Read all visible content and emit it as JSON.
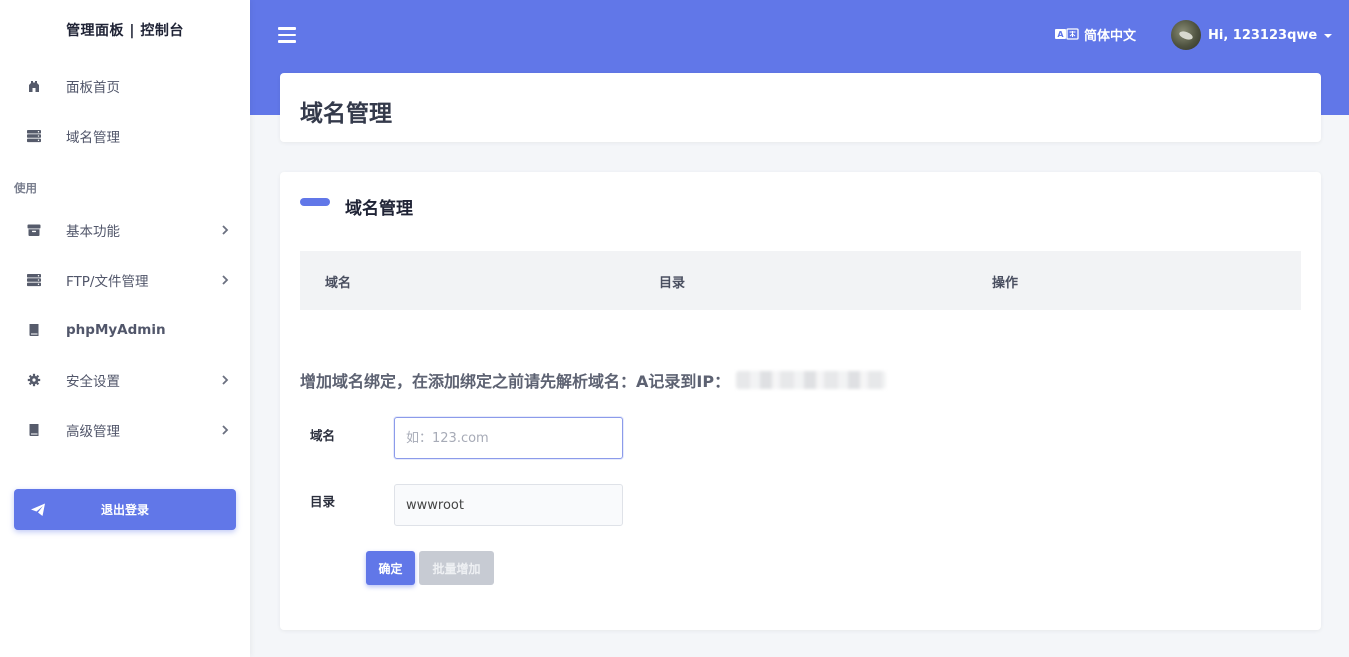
{
  "sidebar": {
    "brand": "管理面板 | 控制台",
    "section_label": "使用",
    "items": [
      {
        "label": "面板首页",
        "icon": "home-icon",
        "has_submenu": false
      },
      {
        "label": "域名管理",
        "icon": "server-icon",
        "has_submenu": false
      },
      {
        "label": "基本功能",
        "icon": "archive-icon",
        "has_submenu": true
      },
      {
        "label": "FTP/文件管理",
        "icon": "server-icon",
        "has_submenu": true
      },
      {
        "label": "phpMyAdmin",
        "icon": "book-icon",
        "has_submenu": false
      },
      {
        "label": "安全设置",
        "icon": "gear-icon",
        "has_submenu": true
      },
      {
        "label": "高级管理",
        "icon": "book-icon",
        "has_submenu": true
      }
    ],
    "logout_label": "退出登录"
  },
  "header": {
    "language_label": "简体中文",
    "user_greeting": "Hi, 123123qwe"
  },
  "page": {
    "title": "域名管理"
  },
  "card": {
    "title": "域名管理",
    "table_headers": [
      "域名",
      "目录",
      "操作"
    ],
    "hint": "增加域名绑定，在添加绑定之前请先解析域名：A记录到IP："
  },
  "form": {
    "domain_label": "域名",
    "domain_placeholder": "如：123.com",
    "domain_value": "",
    "dir_label": "目录",
    "dir_value": "wwwroot",
    "submit_label": "确定",
    "bulk_label": "批量增加"
  },
  "colors": {
    "accent": "#6177e8",
    "background": "#f4f6f9",
    "disabled_button": "#c7cbd3"
  }
}
